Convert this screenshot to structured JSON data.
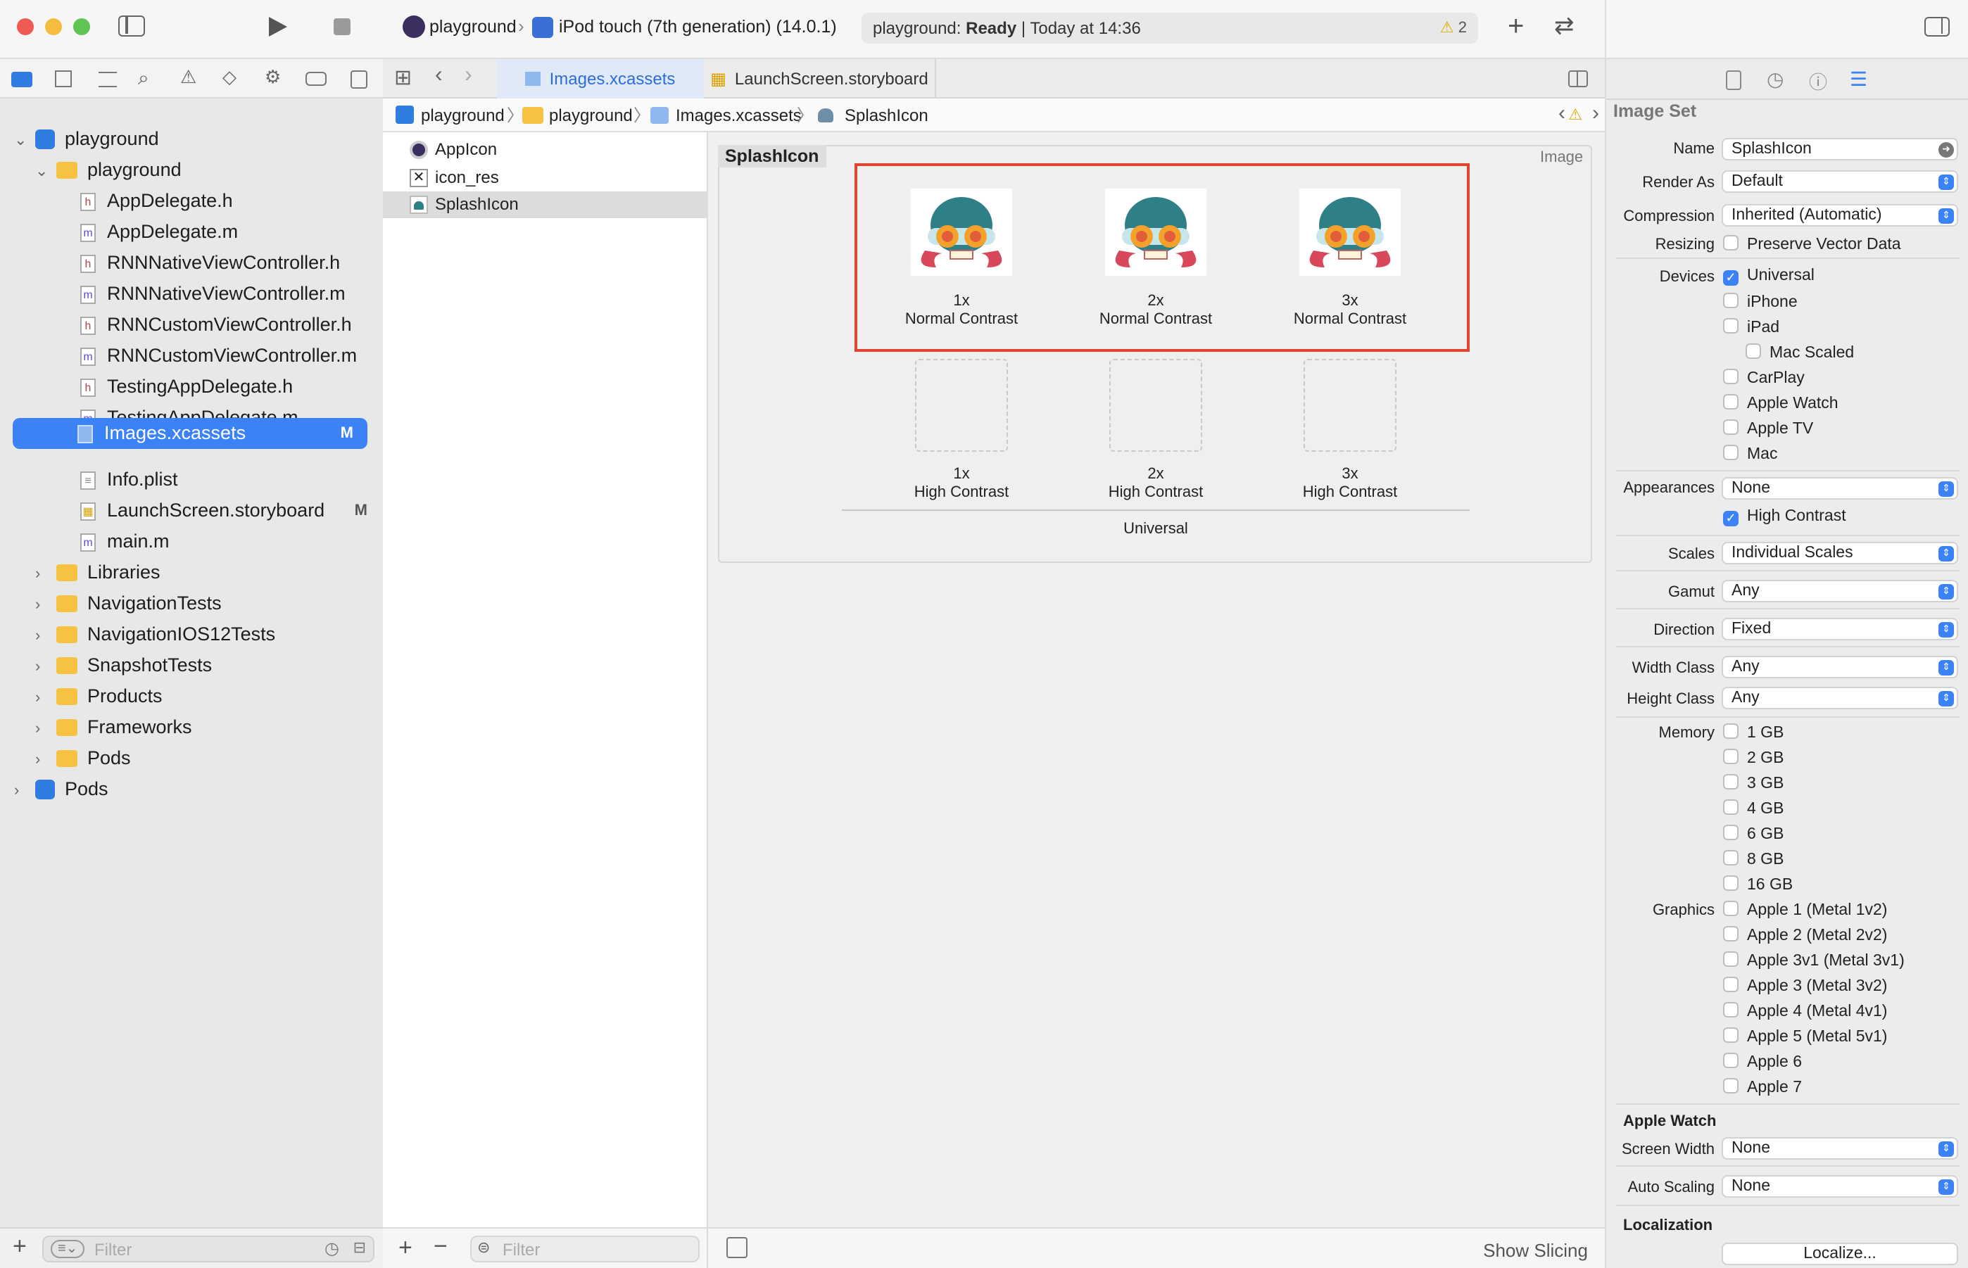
{
  "window": {
    "scheme": "playground",
    "device": "iPod touch (7th generation) (14.0.1)",
    "status_project": "playground:",
    "status_state": "Ready",
    "status_time": "| Today at 14:36",
    "warning_count": "2"
  },
  "tabs": [
    {
      "label": "Images.xcassets"
    },
    {
      "label": "LaunchScreen.storyboard"
    }
  ],
  "breadcrumb": [
    "playground",
    "playground",
    "Images.xcassets",
    "SplashIcon"
  ],
  "navigator": {
    "items": [
      {
        "label": "playground"
      },
      {
        "label": "playground"
      },
      {
        "label": "AppDelegate.h",
        "kind": "h"
      },
      {
        "label": "AppDelegate.m",
        "kind": "m"
      },
      {
        "label": "RNNNativeViewController.h",
        "kind": "h"
      },
      {
        "label": "RNNNativeViewController.m",
        "kind": "m"
      },
      {
        "label": "RNNCustomViewController.h",
        "kind": "h"
      },
      {
        "label": "RNNCustomViewController.m",
        "kind": "m"
      },
      {
        "label": "TestingAppDelegate.h",
        "kind": "h"
      },
      {
        "label": "TestingAppDelegate.m",
        "kind": "m"
      },
      {
        "label": "Images.xcassets",
        "badge": "M"
      },
      {
        "label": "Info.plist"
      },
      {
        "label": "LaunchScreen.storyboard",
        "badge": "M"
      },
      {
        "label": "main.m",
        "kind": "m"
      },
      {
        "label": "Libraries"
      },
      {
        "label": "NavigationTests"
      },
      {
        "label": "NavigationIOS12Tests"
      },
      {
        "label": "SnapshotTests"
      },
      {
        "label": "Products"
      },
      {
        "label": "Frameworks"
      },
      {
        "label": "Pods"
      },
      {
        "label": "Pods"
      }
    ],
    "filter_placeholder": "Filter"
  },
  "assets": {
    "items": [
      "AppIcon",
      "icon_res",
      "SplashIcon"
    ],
    "filter_placeholder": "Filter"
  },
  "canvas": {
    "set_name": "SplashIcon",
    "type_label": "Image",
    "normal": [
      {
        "scale": "1x",
        "label": "Normal Contrast"
      },
      {
        "scale": "2x",
        "label": "Normal Contrast"
      },
      {
        "scale": "3x",
        "label": "Normal Contrast"
      }
    ],
    "high": [
      {
        "scale": "1x",
        "label": "High Contrast"
      },
      {
        "scale": "2x",
        "label": "High Contrast"
      },
      {
        "scale": "3x",
        "label": "High Contrast"
      }
    ],
    "group_label": "Universal",
    "show_slicing": "Show Slicing"
  },
  "inspector": {
    "title": "Image Set",
    "name_label": "Name",
    "name_value": "SplashIcon",
    "render_as_label": "Render As",
    "render_as": "Default",
    "compression_label": "Compression",
    "compression": "Inherited (Automatic)",
    "resizing_label": "Resizing",
    "resizing": "Preserve Vector Data",
    "devices_label": "Devices",
    "devices": [
      {
        "label": "Universal",
        "checked": true
      },
      {
        "label": "iPhone",
        "checked": false
      },
      {
        "label": "iPad",
        "checked": false
      },
      {
        "label": "Mac Scaled",
        "checked": false
      },
      {
        "label": "CarPlay",
        "checked": false
      },
      {
        "label": "Apple Watch",
        "checked": false
      },
      {
        "label": "Apple TV",
        "checked": false
      },
      {
        "label": "Mac",
        "checked": false
      }
    ],
    "appearances_label": "Appearances",
    "appearances": "None",
    "high_contrast": "High Contrast",
    "scales_label": "Scales",
    "scales": "Individual Scales",
    "gamut_label": "Gamut",
    "gamut": "Any",
    "direction_label": "Direction",
    "direction": "Fixed",
    "width_class_label": "Width Class",
    "width_class": "Any",
    "height_class_label": "Height Class",
    "height_class": "Any",
    "memory_label": "Memory",
    "memory": [
      "1 GB",
      "2 GB",
      "3 GB",
      "4 GB",
      "6 GB",
      "8 GB",
      "16 GB"
    ],
    "graphics_label": "Graphics",
    "graphics": [
      "Apple 1 (Metal 1v2)",
      "Apple 2 (Metal 2v2)",
      "Apple 3v1 (Metal 3v1)",
      "Apple 3 (Metal 3v2)",
      "Apple 4 (Metal 4v1)",
      "Apple 5 (Metal 5v1)",
      "Apple 6",
      "Apple 7"
    ],
    "watch_heading": "Apple Watch",
    "screen_width_label": "Screen Width",
    "screen_width": "None",
    "auto_scaling_label": "Auto Scaling",
    "auto_scaling": "None",
    "localization_heading": "Localization",
    "localize_button": "Localize..."
  },
  "colors": {
    "accent": "#3b82f6",
    "highlight_box": "#e0452f"
  }
}
